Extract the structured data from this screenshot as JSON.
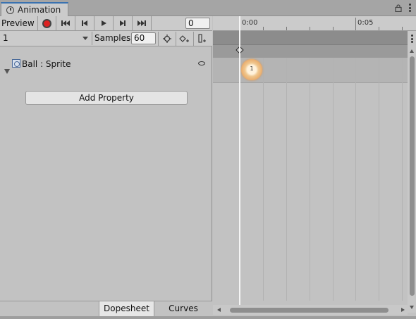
{
  "window": {
    "tab_title": "Animation",
    "tab_icon": "clock-icon",
    "lock_icon": "lock-icon",
    "menu_icon": "kebab-menu-icon"
  },
  "toolbar": {
    "preview_label": "Preview",
    "record_icon": "record-icon",
    "first_key_icon": "first-keyframe-icon",
    "prev_key_icon": "previous-keyframe-icon",
    "play_icon": "play-icon",
    "next_key_icon": "next-keyframe-icon",
    "last_key_icon": "last-keyframe-icon",
    "frame_value": "0"
  },
  "clip_bar": {
    "clip_name": "1",
    "samples_label": "Samples",
    "samples_value": "60",
    "keyframe_icon": "add-keyframe-icon",
    "event_icon": "add-event-icon"
  },
  "properties": [
    {
      "label": "Ball : Sprite",
      "icon": "sprite-renderer-icon"
    }
  ],
  "add_property_label": "Add Property",
  "bottom_tabs": [
    {
      "label": "Dopesheet",
      "active": true
    },
    {
      "label": "Curves",
      "active": false
    }
  ],
  "timeline": {
    "tick_labels": [
      "0:00",
      "0:05"
    ],
    "keyframe_label": "1"
  },
  "colors": {
    "record": "#d22222",
    "tab_accent": "#3a72b0",
    "keyframe": "#e8a765"
  }
}
